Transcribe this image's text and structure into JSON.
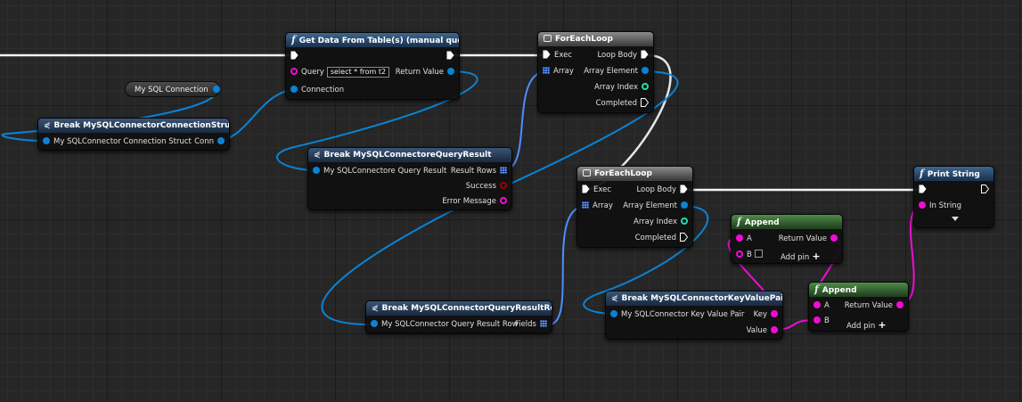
{
  "colors": {
    "exec": "#ffffff",
    "object": "#0a83d6",
    "string": "#f10cd5",
    "boolean": "#8c0000",
    "integer": "#1fdfa5",
    "array": "#4d8fff",
    "function_header": "#3e668f",
    "pure_header": "#4f8c48",
    "macro_header": "#8c8c8c",
    "background": "#262626"
  },
  "nodes": {
    "get_data": {
      "title": "Get Data From Table(s) (manual query)",
      "icon": "function-icon",
      "query_label": "Query",
      "query_value": "select * from t2",
      "connection_label": "Connection",
      "return_label": "Return Value"
    },
    "my_sql_connection": {
      "label": "My SQL Connection"
    },
    "break_conn_struct": {
      "title": "Break MySQLConnectorConnectionStruct",
      "input_label": "My SQLConnector Connection Struct",
      "output_label": "Conn"
    },
    "break_query_result": {
      "title": "Break MySQLConnectoreQueryResult",
      "input_label": "My SQLConnectore Query Result",
      "out_rows": "Result Rows",
      "out_success": "Success",
      "out_error": "Error Message"
    },
    "foreach_1": {
      "title": "ForEachLoop",
      "in_exec": "Exec",
      "in_array": "Array",
      "out_body": "Loop Body",
      "out_element": "Array Element",
      "out_index": "Array Index",
      "out_completed": "Completed"
    },
    "foreach_2": {
      "title": "ForEachLoop",
      "in_exec": "Exec",
      "in_array": "Array",
      "out_body": "Loop Body",
      "out_element": "Array Element",
      "out_index": "Array Index",
      "out_completed": "Completed"
    },
    "print_string": {
      "title": "Print String",
      "in_string": "In String"
    },
    "append_1": {
      "title": "Append",
      "a": "A",
      "b": "B",
      "return_label": "Return Value",
      "add_pin": "Add pin"
    },
    "append_2": {
      "title": "Append",
      "a": "A",
      "b": "B",
      "return_label": "Return Value",
      "add_pin": "Add pin"
    },
    "break_row": {
      "title": "Break MySQLConnectorQueryResultRow",
      "input_label": "My SQLConnector Query Result Row",
      "output_label": "Fields"
    },
    "break_kv": {
      "title": "Break MySQLConnectorKeyValuePair",
      "input_label": "My SQLConnector Key Value Pair",
      "out_key": "Key",
      "out_value": "Value"
    }
  }
}
